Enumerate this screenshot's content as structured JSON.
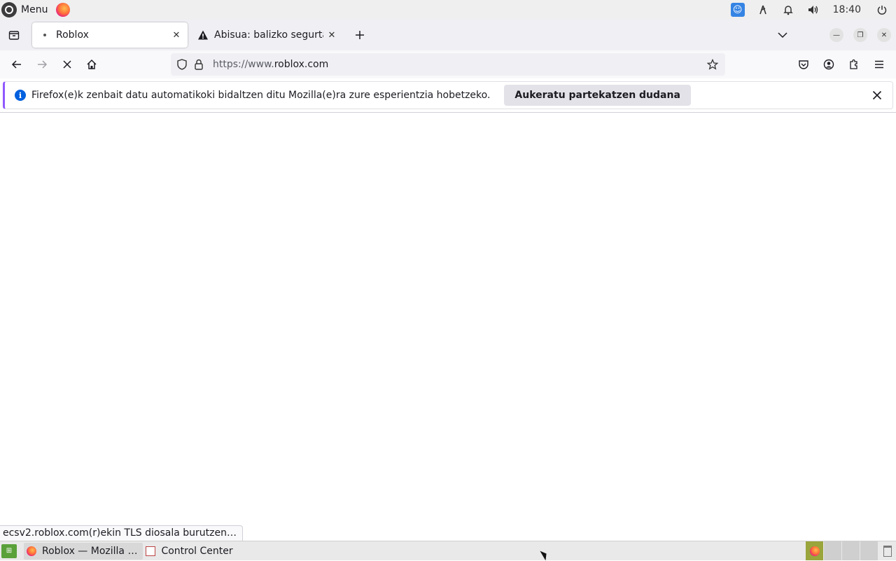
{
  "system_panel": {
    "menu_label": "Menu",
    "clock": "18:40",
    "icons": [
      "accessibility-icon",
      "network-icon",
      "bell-icon",
      "volume-icon",
      "power-icon"
    ]
  },
  "tabs": [
    {
      "title": "Roblox",
      "icon": "loading-dot",
      "active": true
    },
    {
      "title": "Abisua: balizko segurtasu",
      "icon": "warning-icon",
      "active": false
    }
  ],
  "navbar": {
    "url_prefix": "https://www.",
    "url_domain": "roblox.com"
  },
  "notification": {
    "message": "Firefox(e)k zenbait datu automatikoki bidaltzen ditu Mozilla(e)ra zure esperientzia hobetzeko.",
    "button_label": "Aukeratu partekatzen dudana"
  },
  "status_text": "ecsv2.roblox.com(r)ekin TLS diosala burutzen…",
  "taskbar": {
    "items": [
      {
        "label": "Roblox — Mozilla …",
        "icon": "firefox-icon",
        "active": true
      },
      {
        "label": "Control Center",
        "icon": "control-center-icon",
        "active": false
      }
    ]
  },
  "colors": {
    "accent": "#9059ff",
    "info": "#0060df",
    "workspace_active": "#9aa53c"
  }
}
